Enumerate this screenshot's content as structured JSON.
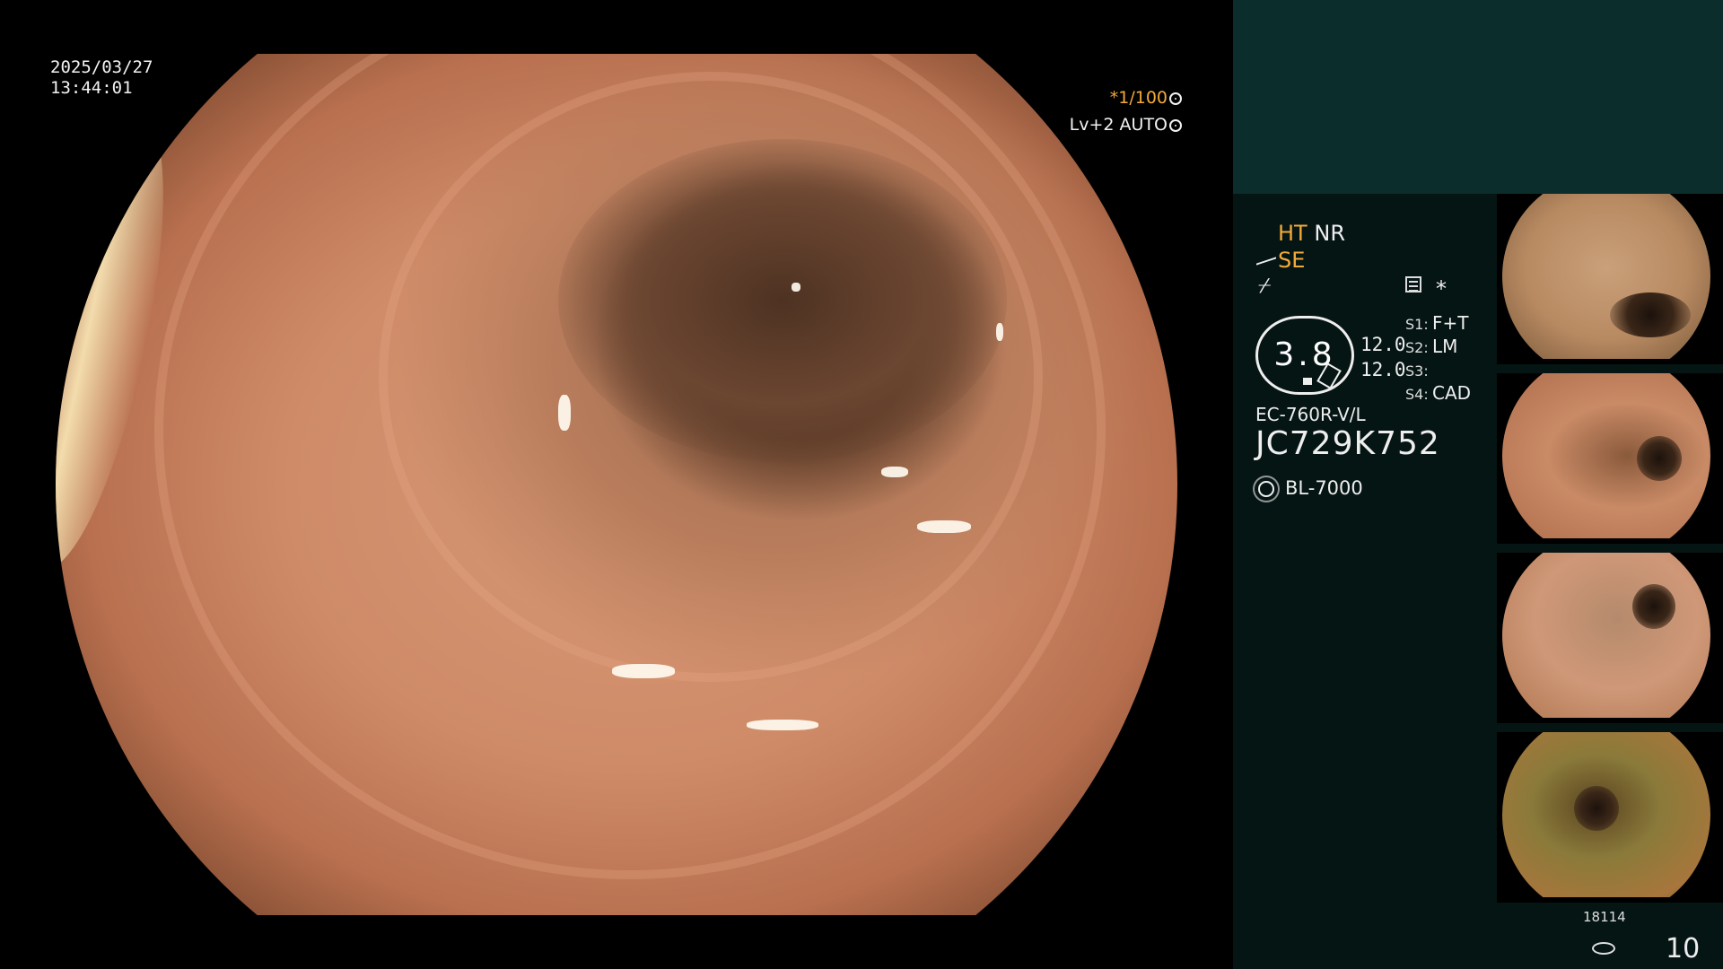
{
  "main_view": {
    "date": "2025/03/27",
    "time": "13:44:01",
    "shutter": "*1/100",
    "level": "Lv+2 AUTO"
  },
  "settings": {
    "ht": "HT",
    "nr": "NR",
    "se": "SE",
    "zap_symbol": "⌿",
    "star": "*"
  },
  "gauge": {
    "value": "3.8",
    "val1": "12.0",
    "val2": "12.0"
  },
  "switches": [
    {
      "label": "S1:",
      "value": "F+T"
    },
    {
      "label": "S2:",
      "value": "LM"
    },
    {
      "label": "S3:",
      "value": ""
    },
    {
      "label": "S4:",
      "value": "CAD"
    }
  ],
  "scope": {
    "model": "EC-760R-V/L",
    "serial": "JC729K752",
    "light_source": "BL-7000"
  },
  "footer": {
    "count": "18114",
    "page": "10"
  },
  "colors": {
    "accent": "#f2a93b",
    "panel_top": "#0b2d2b",
    "panel_bottom": "#051513"
  }
}
